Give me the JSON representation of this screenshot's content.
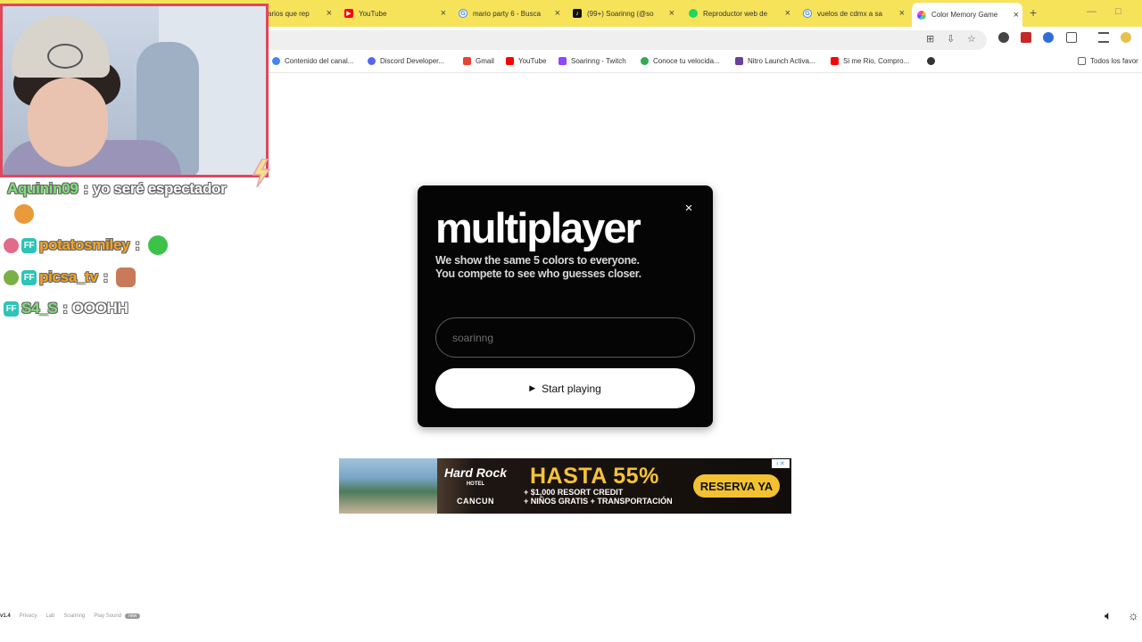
{
  "browser": {
    "tabs": [
      {
        "label": "arios que rep",
        "favicon": "overflow-tab",
        "color": "#f7e35a"
      },
      {
        "label": "YouTube",
        "favicon": "youtube-icon",
        "color": "#ff0000"
      },
      {
        "label": "mario party 6 - Busca",
        "favicon": "google-icon",
        "color": "#4285f4"
      },
      {
        "label": "(99+) Soarinng (@so",
        "favicon": "tiktok-icon",
        "color": "#111111"
      },
      {
        "label": "Reproductor web de",
        "favicon": "spotify-icon",
        "color": "#1ed760"
      },
      {
        "label": "vuelos de cdmx a sa",
        "favicon": "google-icon",
        "color": "#4285f4"
      },
      {
        "label": "Color Memory Game",
        "favicon": "colorwheel-icon",
        "color": "#e040a0"
      }
    ],
    "bookmarks": [
      {
        "label": "Contenido del canal...",
        "color": "#4285f4"
      },
      {
        "label": "Discord Developer...",
        "color": "#5865f2"
      },
      {
        "label": "Gmail",
        "color": "#ea4335"
      },
      {
        "label": "YouTube",
        "color": "#ff0000"
      },
      {
        "label": "Soarinng - Twitch",
        "color": "#9146ff"
      },
      {
        "label": "Conoce tu velocida...",
        "color": "#34a853"
      },
      {
        "label": "Nitro Launch Activa...",
        "color": "#6a3fa0"
      },
      {
        "label": "Si me Rio, Compro...",
        "color": "#ff0000"
      }
    ],
    "bookmarks_folder": "Todos los favor"
  },
  "chat": [
    {
      "user": "Aquinin09",
      "user_color": "#7fe07a",
      "message": "yo seré espectador",
      "badges": []
    },
    {
      "user": "potatosmiley",
      "user_color": "#f5a524",
      "message": "",
      "badges": [
        "pink",
        "teal"
      ]
    },
    {
      "user": "picsa_tv",
      "user_color": "#f5a524",
      "message": "",
      "badges": [
        "green",
        "teal"
      ]
    },
    {
      "user": "S4_S",
      "user_color": "#7fe07a",
      "message": "OOOHH",
      "badges": [
        "teal"
      ]
    }
  ],
  "modal": {
    "title": "multiplayer",
    "description_line1": "We show the same 5 colors to everyone.",
    "description_line2": "You compete to see who guesses closer.",
    "name_placeholder": "soarinng",
    "start_label": "Start playing",
    "close_symbol": "×"
  },
  "ad": {
    "brand": "Hard Rock",
    "brand_sub": "HOTEL",
    "brand_location": "CANCUN",
    "headline": "HASTA 55%",
    "line1": "+ $1,000 RESORT CREDIT",
    "line2": "+ NIÑOS GRATIS + TRANSPORTACIÓN",
    "cta": "RESERVA YA",
    "adchoices": "i ✕"
  },
  "footer": {
    "version": "v1.4",
    "links": [
      "Privacy",
      "Lab",
      "Soarinng",
      "Play Sound"
    ],
    "new_badge": "new"
  }
}
